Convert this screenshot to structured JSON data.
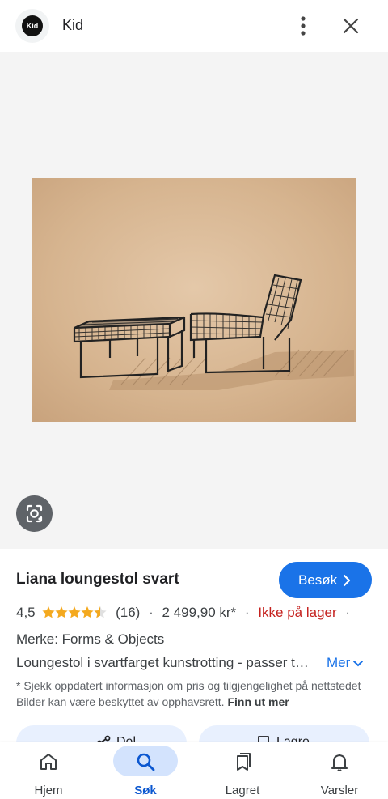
{
  "header": {
    "logo_text": "Kid",
    "site_name": "Kid",
    "more_icon": "more-vert-icon",
    "close_icon": "close-icon"
  },
  "image": {
    "lens_icon": "lens-icon"
  },
  "product": {
    "title": "Liana loungestol svart",
    "visit_label": "Besøk",
    "rating": "4,5",
    "stars": 4.5,
    "reviews": "(16)",
    "separator": "·",
    "price": "2 499,90 kr*",
    "stock": "Ikke på lager",
    "brand": "Merke: Forms & Objects",
    "description": "Loungestol i svartfarget kunstrotting - passer til både innendørs og utendørs bruk",
    "more_label": "Mer",
    "disclaimer": "* Sjekk oppdatert informasjon om pris og tilgjengelighet på nettstedet Bilder kan være beskyttet av opphavsrett.",
    "learn_more": "Finn ut mer",
    "share_label": "Del",
    "save_label": "Lagre"
  },
  "colors": {
    "accent": "#1a73e8",
    "stock_red": "#c5221f",
    "star": "#f4a91e",
    "nav_active": "#d3e3fd"
  },
  "nav": {
    "items": [
      {
        "label": "Hjem",
        "icon": "home-icon"
      },
      {
        "label": "Søk",
        "icon": "search-icon",
        "active": true
      },
      {
        "label": "Lagret",
        "icon": "bookmarks-icon"
      },
      {
        "label": "Varsler",
        "icon": "bell-icon"
      }
    ]
  }
}
